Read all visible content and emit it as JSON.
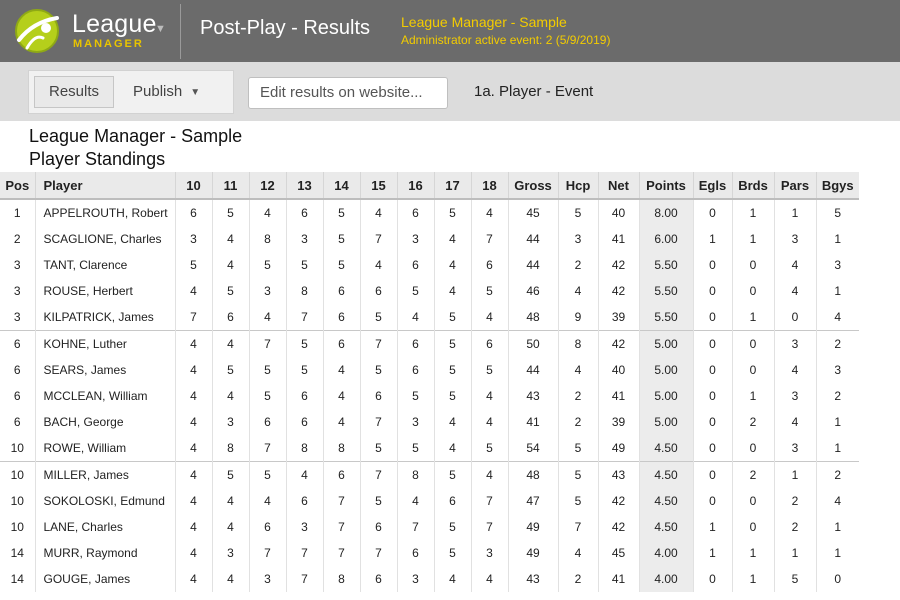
{
  "header": {
    "brand_name": "League",
    "brand_sub": "MANAGER",
    "page_title": "Post-Play - Results",
    "event_name": "League Manager - Sample",
    "event_info": "Administrator active event: 2 (5/9/2019)"
  },
  "toolbar": {
    "results_label": "Results",
    "publish_label": "Publish",
    "edit_label": "Edit results on website...",
    "report_label": "1a. Player - Event"
  },
  "report": {
    "title": "League Manager - Sample",
    "subtitle": "Player Standings"
  },
  "table": {
    "columns": [
      "Pos",
      "Player",
      "10",
      "11",
      "12",
      "13",
      "14",
      "15",
      "16",
      "17",
      "18",
      "Gross",
      "Hcp",
      "Net",
      "Points",
      "Egls",
      "Brds",
      "Pars",
      "Bgys"
    ],
    "rows": [
      [
        "1",
        "APPELROUTH, Robert",
        "6",
        "5",
        "4",
        "6",
        "5",
        "4",
        "6",
        "5",
        "4",
        "45",
        "5",
        "40",
        "8.00",
        "0",
        "1",
        "1",
        "5"
      ],
      [
        "2",
        "SCAGLIONE, Charles",
        "3",
        "4",
        "8",
        "3",
        "5",
        "7",
        "3",
        "4",
        "7",
        "44",
        "3",
        "41",
        "6.00",
        "1",
        "1",
        "3",
        "1"
      ],
      [
        "3",
        "TANT, Clarence",
        "5",
        "4",
        "5",
        "5",
        "5",
        "4",
        "6",
        "4",
        "6",
        "44",
        "2",
        "42",
        "5.50",
        "0",
        "0",
        "4",
        "3"
      ],
      [
        "3",
        "ROUSE, Herbert",
        "4",
        "5",
        "3",
        "8",
        "6",
        "6",
        "5",
        "4",
        "5",
        "46",
        "4",
        "42",
        "5.50",
        "0",
        "0",
        "4",
        "1"
      ],
      [
        "3",
        "KILPATRICK, James",
        "7",
        "6",
        "4",
        "7",
        "6",
        "5",
        "4",
        "5",
        "4",
        "48",
        "9",
        "39",
        "5.50",
        "0",
        "1",
        "0",
        "4"
      ],
      [
        "6",
        "KOHNE, Luther",
        "4",
        "4",
        "7",
        "5",
        "6",
        "7",
        "6",
        "5",
        "6",
        "50",
        "8",
        "42",
        "5.00",
        "0",
        "0",
        "3",
        "2"
      ],
      [
        "6",
        "SEARS, James",
        "4",
        "5",
        "5",
        "5",
        "4",
        "5",
        "6",
        "5",
        "5",
        "44",
        "4",
        "40",
        "5.00",
        "0",
        "0",
        "4",
        "3"
      ],
      [
        "6",
        "MCCLEAN, William",
        "4",
        "4",
        "5",
        "6",
        "4",
        "6",
        "5",
        "5",
        "4",
        "43",
        "2",
        "41",
        "5.00",
        "0",
        "1",
        "3",
        "2"
      ],
      [
        "6",
        "BACH, George",
        "4",
        "3",
        "6",
        "6",
        "4",
        "7",
        "3",
        "4",
        "4",
        "41",
        "2",
        "39",
        "5.00",
        "0",
        "2",
        "4",
        "1"
      ],
      [
        "10",
        "ROWE, William",
        "4",
        "8",
        "7",
        "8",
        "8",
        "5",
        "5",
        "4",
        "5",
        "54",
        "5",
        "49",
        "4.50",
        "0",
        "0",
        "3",
        "1"
      ],
      [
        "10",
        "MILLER, James",
        "4",
        "5",
        "5",
        "4",
        "6",
        "7",
        "8",
        "5",
        "4",
        "48",
        "5",
        "43",
        "4.50",
        "0",
        "2",
        "1",
        "2"
      ],
      [
        "10",
        "SOKOLOSKI, Edmund",
        "4",
        "4",
        "4",
        "6",
        "7",
        "5",
        "4",
        "6",
        "7",
        "47",
        "5",
        "42",
        "4.50",
        "0",
        "0",
        "2",
        "4"
      ],
      [
        "10",
        "LANE, Charles",
        "4",
        "4",
        "6",
        "3",
        "7",
        "6",
        "7",
        "5",
        "7",
        "49",
        "7",
        "42",
        "4.50",
        "1",
        "0",
        "2",
        "1"
      ],
      [
        "14",
        "MURR, Raymond",
        "4",
        "3",
        "7",
        "7",
        "7",
        "7",
        "6",
        "5",
        "3",
        "49",
        "4",
        "45",
        "4.00",
        "1",
        "1",
        "1",
        "1"
      ],
      [
        "14",
        "GOUGE, James",
        "4",
        "4",
        "3",
        "7",
        "8",
        "6",
        "3",
        "4",
        "4",
        "43",
        "2",
        "41",
        "4.00",
        "0",
        "1",
        "5",
        "0"
      ]
    ]
  }
}
